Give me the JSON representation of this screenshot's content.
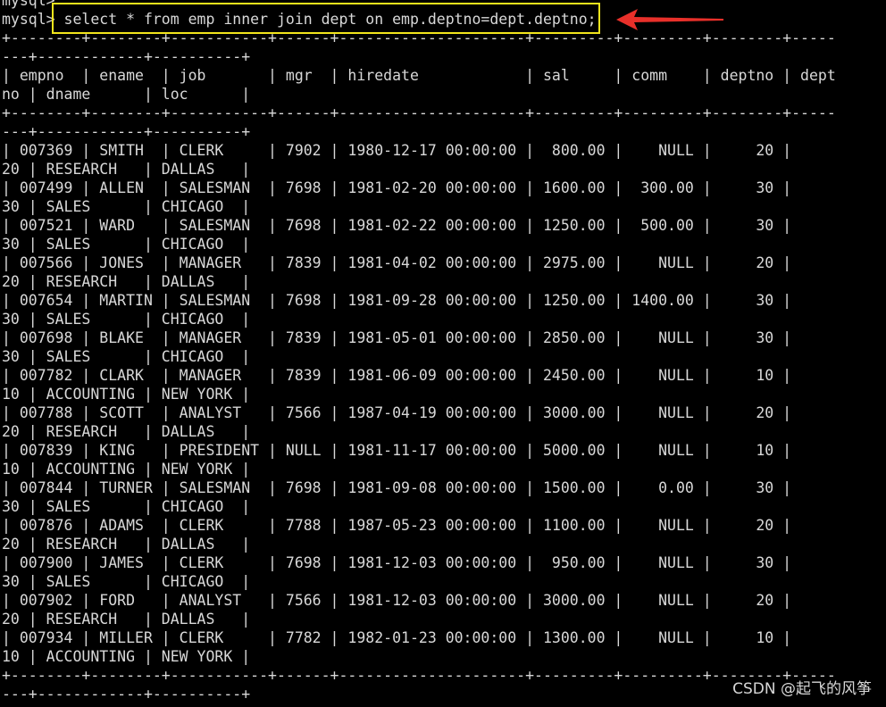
{
  "terminal": {
    "lines": [
      "mysql>",
      "mysql> select * from emp inner join dept on emp.deptno=dept.deptno;",
      "+--------+--------+-----------+------+---------------------+---------+---------+--------+-----",
      "---+------------+----------+",
      "| empno  | ename  | job       | mgr  | hiredate            | sal     | comm    | deptno | dept",
      "no | dname      | loc      |",
      "+--------+--------+-----------+------+---------------------+---------+---------+--------+-----",
      "---+------------+----------+",
      "| 007369 | SMITH  | CLERK     | 7902 | 1980-12-17 00:00:00 |  800.00 |    NULL |     20 |",
      "20 | RESEARCH   | DALLAS   |",
      "| 007499 | ALLEN  | SALESMAN  | 7698 | 1981-02-20 00:00:00 | 1600.00 |  300.00 |     30 |",
      "30 | SALES      | CHICAGO  |",
      "| 007521 | WARD   | SALESMAN  | 7698 | 1981-02-22 00:00:00 | 1250.00 |  500.00 |     30 |",
      "30 | SALES      | CHICAGO  |",
      "| 007566 | JONES  | MANAGER   | 7839 | 1981-04-02 00:00:00 | 2975.00 |    NULL |     20 |",
      "20 | RESEARCH   | DALLAS   |",
      "| 007654 | MARTIN | SALESMAN  | 7698 | 1981-09-28 00:00:00 | 1250.00 | 1400.00 |     30 |",
      "30 | SALES      | CHICAGO  |",
      "| 007698 | BLAKE  | MANAGER   | 7839 | 1981-05-01 00:00:00 | 2850.00 |    NULL |     30 |",
      "30 | SALES      | CHICAGO  |",
      "| 007782 | CLARK  | MANAGER   | 7839 | 1981-06-09 00:00:00 | 2450.00 |    NULL |     10 |",
      "10 | ACCOUNTING | NEW YORK |",
      "| 007788 | SCOTT  | ANALYST   | 7566 | 1987-04-19 00:00:00 | 3000.00 |    NULL |     20 |",
      "20 | RESEARCH   | DALLAS   |",
      "| 007839 | KING   | PRESIDENT | NULL | 1981-11-17 00:00:00 | 5000.00 |    NULL |     10 |",
      "10 | ACCOUNTING | NEW YORK |",
      "| 007844 | TURNER | SALESMAN  | 7698 | 1981-09-08 00:00:00 | 1500.00 |    0.00 |     30 |",
      "30 | SALES      | CHICAGO  |",
      "| 007876 | ADAMS  | CLERK     | 7788 | 1987-05-23 00:00:00 | 1100.00 |    NULL |     20 |",
      "20 | RESEARCH   | DALLAS   |",
      "| 007900 | JAMES  | CLERK     | 7698 | 1981-12-03 00:00:00 |  950.00 |    NULL |     30 |",
      "30 | SALES      | CHICAGO  |",
      "| 007902 | FORD   | ANALYST   | 7566 | 1981-12-03 00:00:00 | 3000.00 |    NULL |     20 |",
      "20 | RESEARCH   | DALLAS   |",
      "| 007934 | MILLER | CLERK     | 7782 | 1982-01-23 00:00:00 | 1300.00 |    NULL |     10 |",
      "10 | ACCOUNTING | NEW YORK |",
      "+--------+--------+-----------+------+---------------------+---------+---------+--------+-----",
      "---+------------+----------+"
    ]
  },
  "annotations": {
    "highlight_color": "#f2e51c",
    "arrow_color": "#e8302a",
    "arrow_icon": "red-arrow-left-icon"
  },
  "watermark": {
    "text": "CSDN @起飞的风筝"
  },
  "colors": {
    "background": "#000000",
    "text": "#d8d8d8"
  }
}
